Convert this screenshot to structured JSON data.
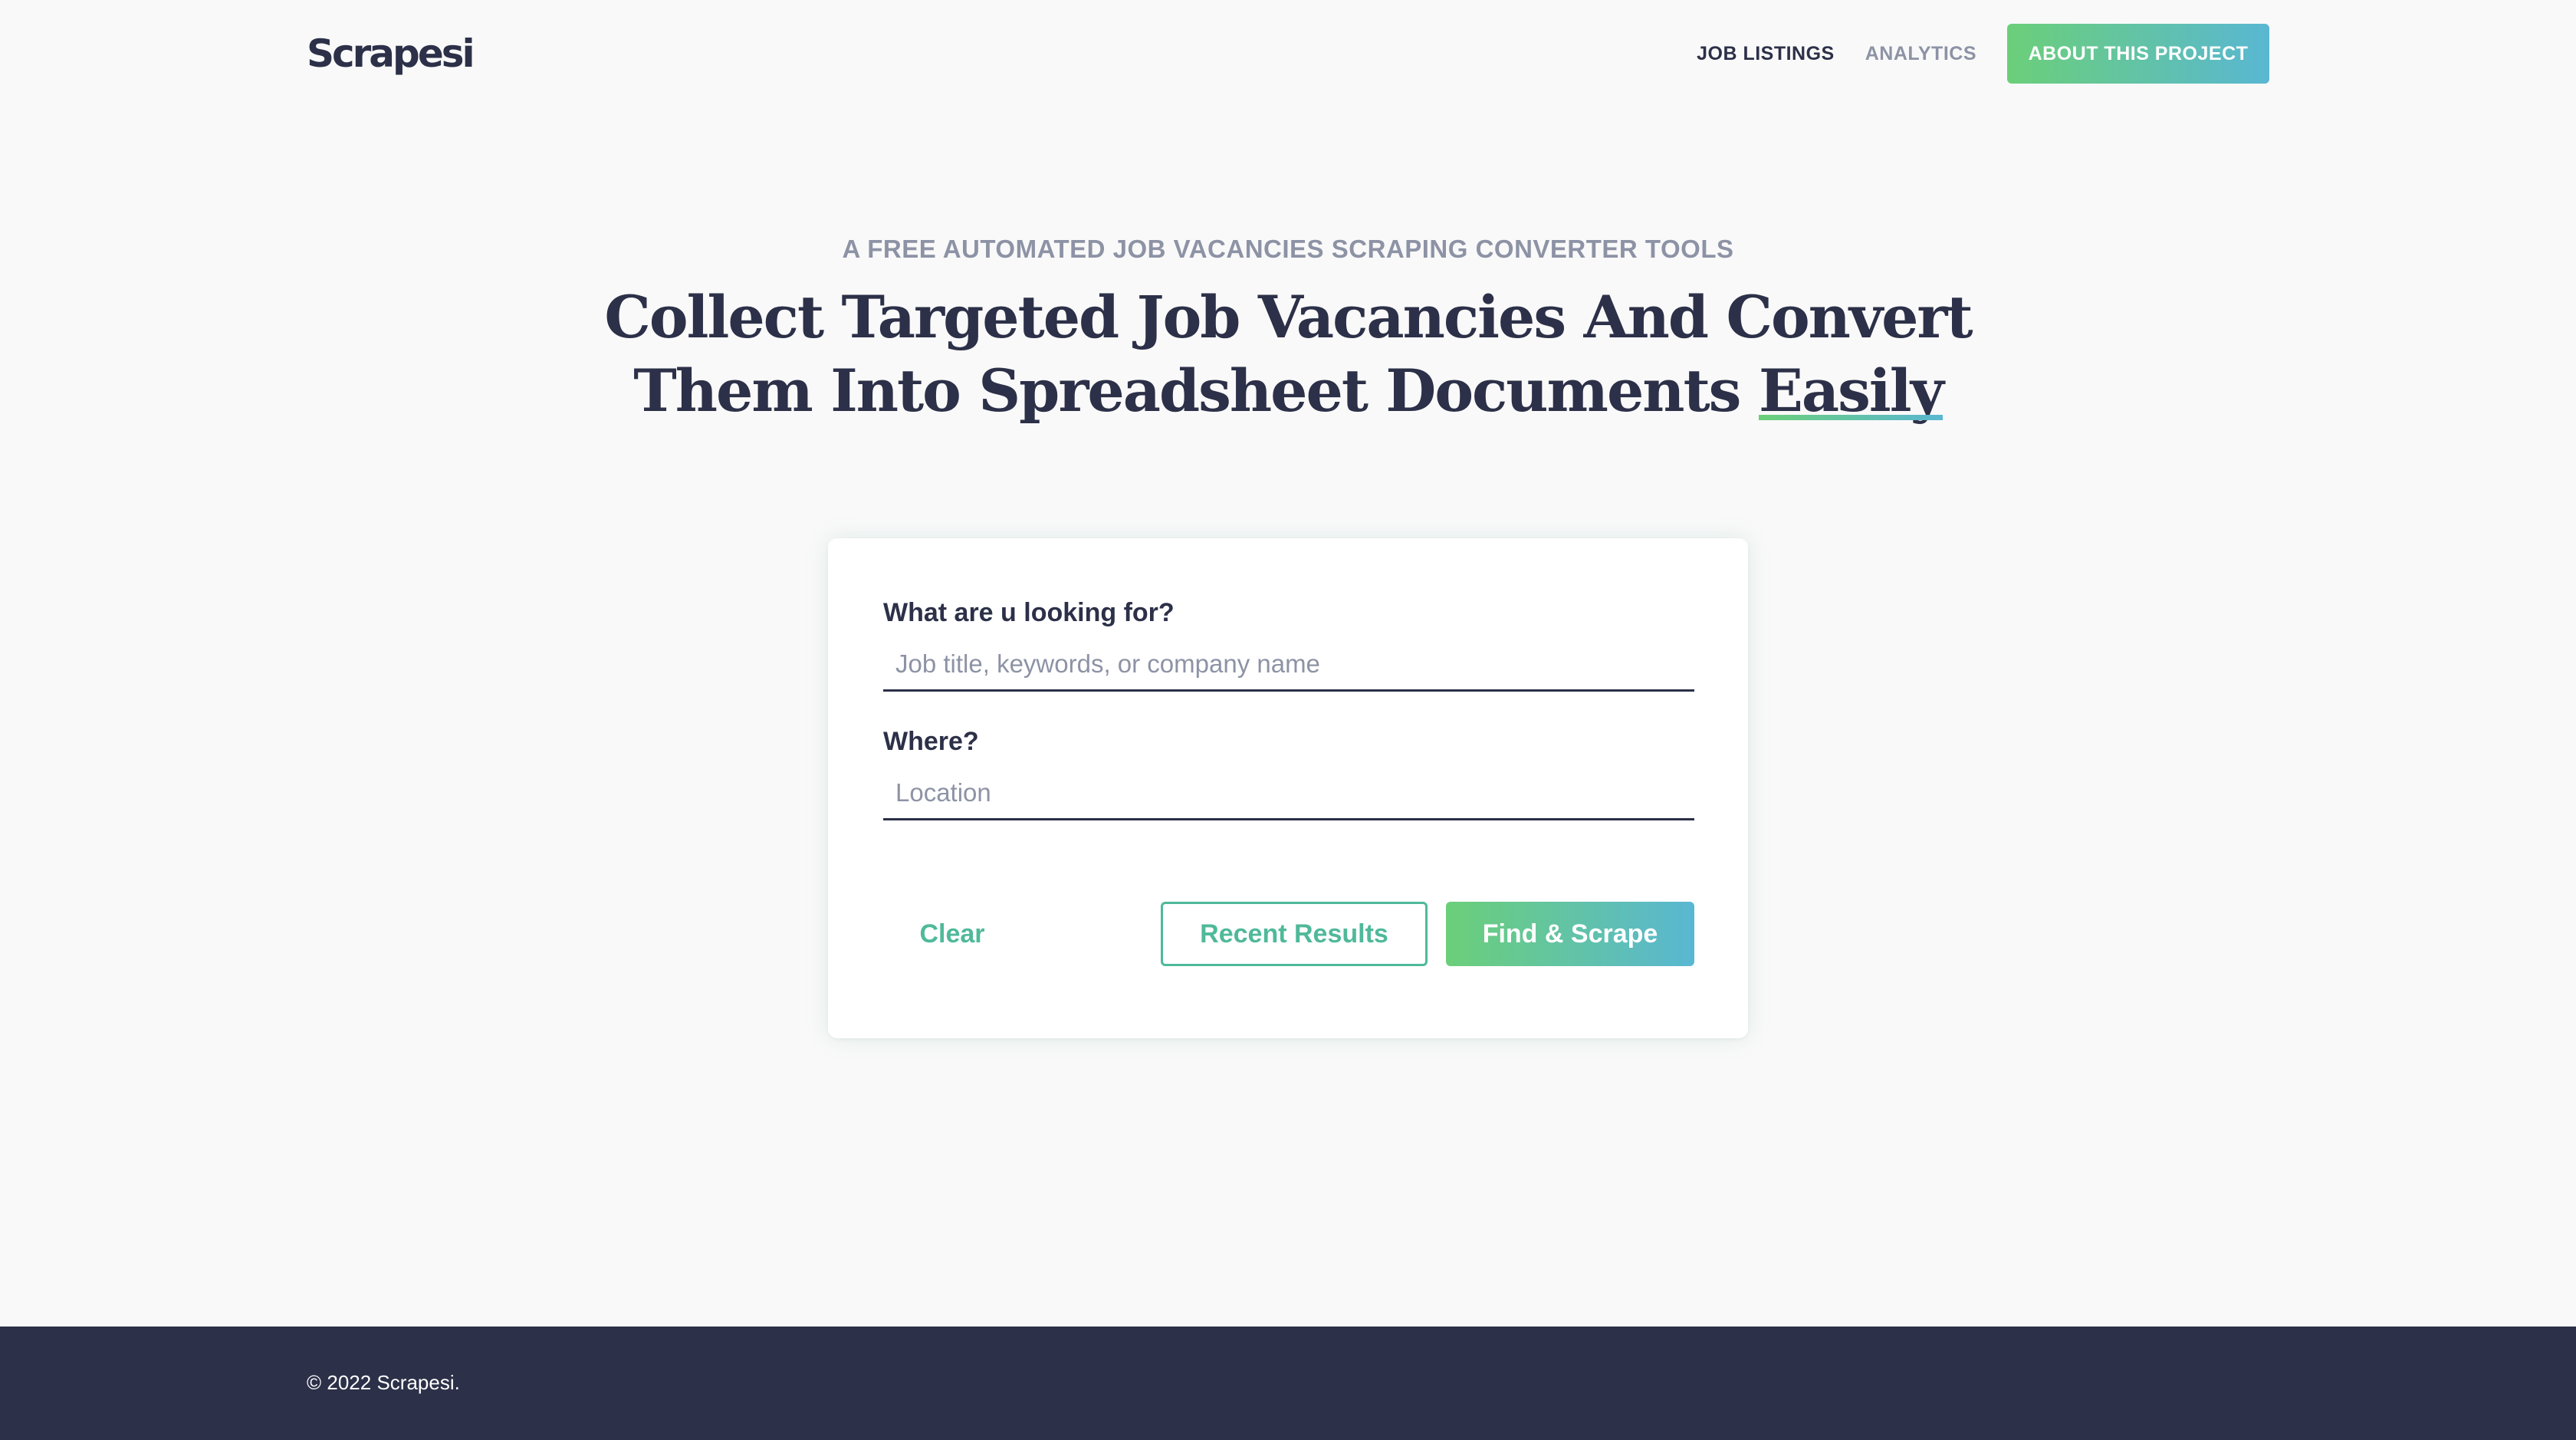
{
  "header": {
    "logo": "Scrapesi",
    "nav": {
      "job_listings": "JOB LISTINGS",
      "analytics": "ANALYTICS",
      "about": "ABOUT THIS PROJECT"
    }
  },
  "hero": {
    "eyebrow": "A FREE AUTOMATED JOB VACANCIES SCRAPING CONVERTER TOOLS",
    "headline_line1": "Collect Targeted Job Vacancies And Convert",
    "headline_line2": "Them Into Spreadsheet Documents",
    "headline_accent": "Easily"
  },
  "search_form": {
    "what_label": "What are u looking for?",
    "what_placeholder": "Job title, keywords, or company name",
    "what_value": "",
    "where_label": "Where?",
    "where_placeholder": "Location",
    "where_value": "",
    "clear_label": "Clear",
    "recent_label": "Recent Results",
    "find_label": "Find & Scrape"
  },
  "footer": {
    "copyright": "© 2022 Scrapesi."
  },
  "colors": {
    "navy": "#2c3048",
    "muted": "#8d93a5",
    "accent_green": "#6bcf79",
    "accent_blue": "#59b7d2",
    "teal_text": "#4fb99a",
    "background": "#f9f9f9"
  }
}
